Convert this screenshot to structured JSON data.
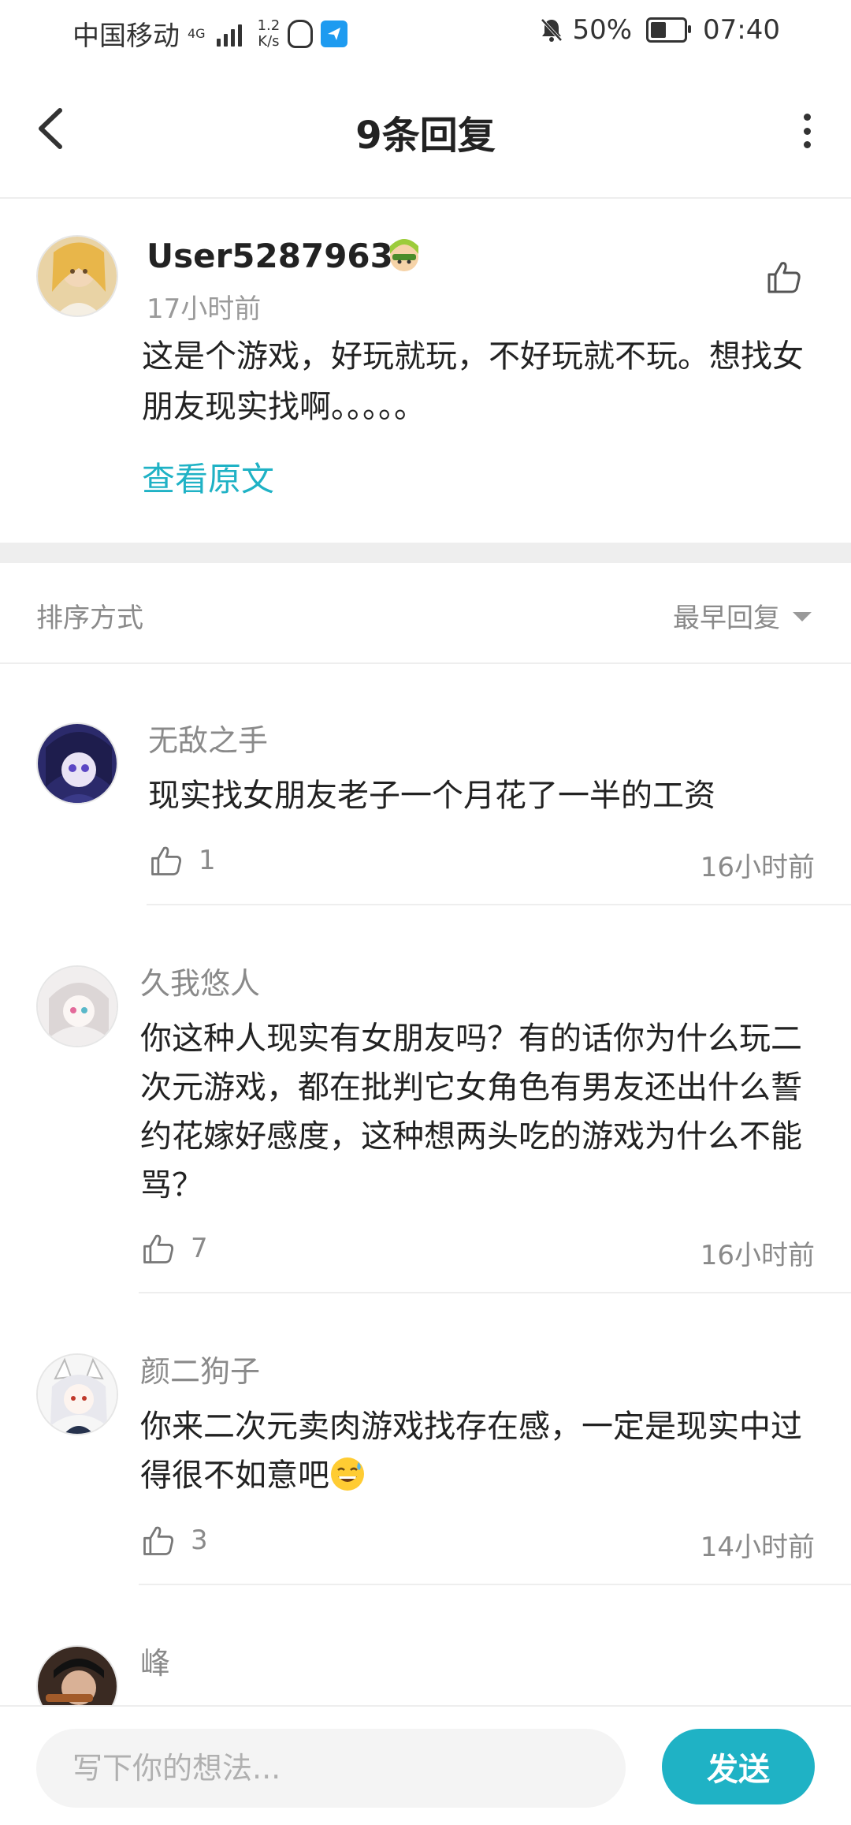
{
  "status_bar": {
    "carrier": "中国移动",
    "net": "4G",
    "speed_value": "1.2",
    "speed_unit": "K/s",
    "battery": "50%",
    "time": "07:40"
  },
  "header": {
    "title": "9条回复"
  },
  "main_post": {
    "username": "User52879632",
    "time": "17小时前",
    "text": "这是个游戏，好玩就玩，不好玩就不玩。想找女朋友现实找啊。。。。。",
    "view_original": "查看原文"
  },
  "sort": {
    "label": "排序方式",
    "value": "最早回复"
  },
  "replies": [
    {
      "name": "无敌之手",
      "text": "现实找女朋友老子一个月花了一半的工资",
      "likes": "1",
      "time": "16小时前"
    },
    {
      "name": "久我悠人",
      "text": "你这种人现实有女朋友吗？有的话你为什么玩二次元游戏，都在批判它女角色有男友还出什么誓约花嫁好感度，这种想两头吃的游戏为什么不能骂？",
      "likes": "7",
      "time": "16小时前"
    },
    {
      "name": "颜二狗子",
      "text": "你来二次元卖肉游戏找存在感，一定是现实中过得很不如意吧",
      "likes": "3",
      "time": "14小时前"
    },
    {
      "name": "峰"
    }
  ],
  "composer": {
    "placeholder": "写下你的想法...",
    "send_label": "发送"
  },
  "colors": {
    "accent": "#1fb2c5",
    "muted": "#8a8a8a",
    "divider": "#eeeeee"
  }
}
